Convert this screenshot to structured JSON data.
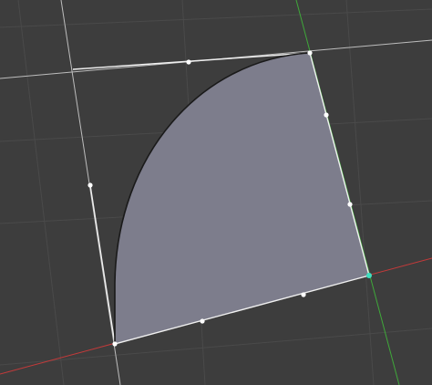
{
  "viewport": {
    "mode": "edit-mode-3d-viewport",
    "background_color": "#3d3d3d",
    "grid_color": "#4a4a4a",
    "reference_line_color": "#bdbdbd"
  },
  "axes": {
    "x_axis_color": "#c23a3a",
    "y_axis_color": "#3fa83a"
  },
  "face": {
    "fill_color": "#7d7d8c",
    "edge_color": "#f0f0f0",
    "arc_edge_color": "#1a1a1a",
    "selected": true
  },
  "vertices": {
    "color": "#ffffff",
    "active_color": "#3fe0c0",
    "count": 10,
    "active_count": 1
  }
}
